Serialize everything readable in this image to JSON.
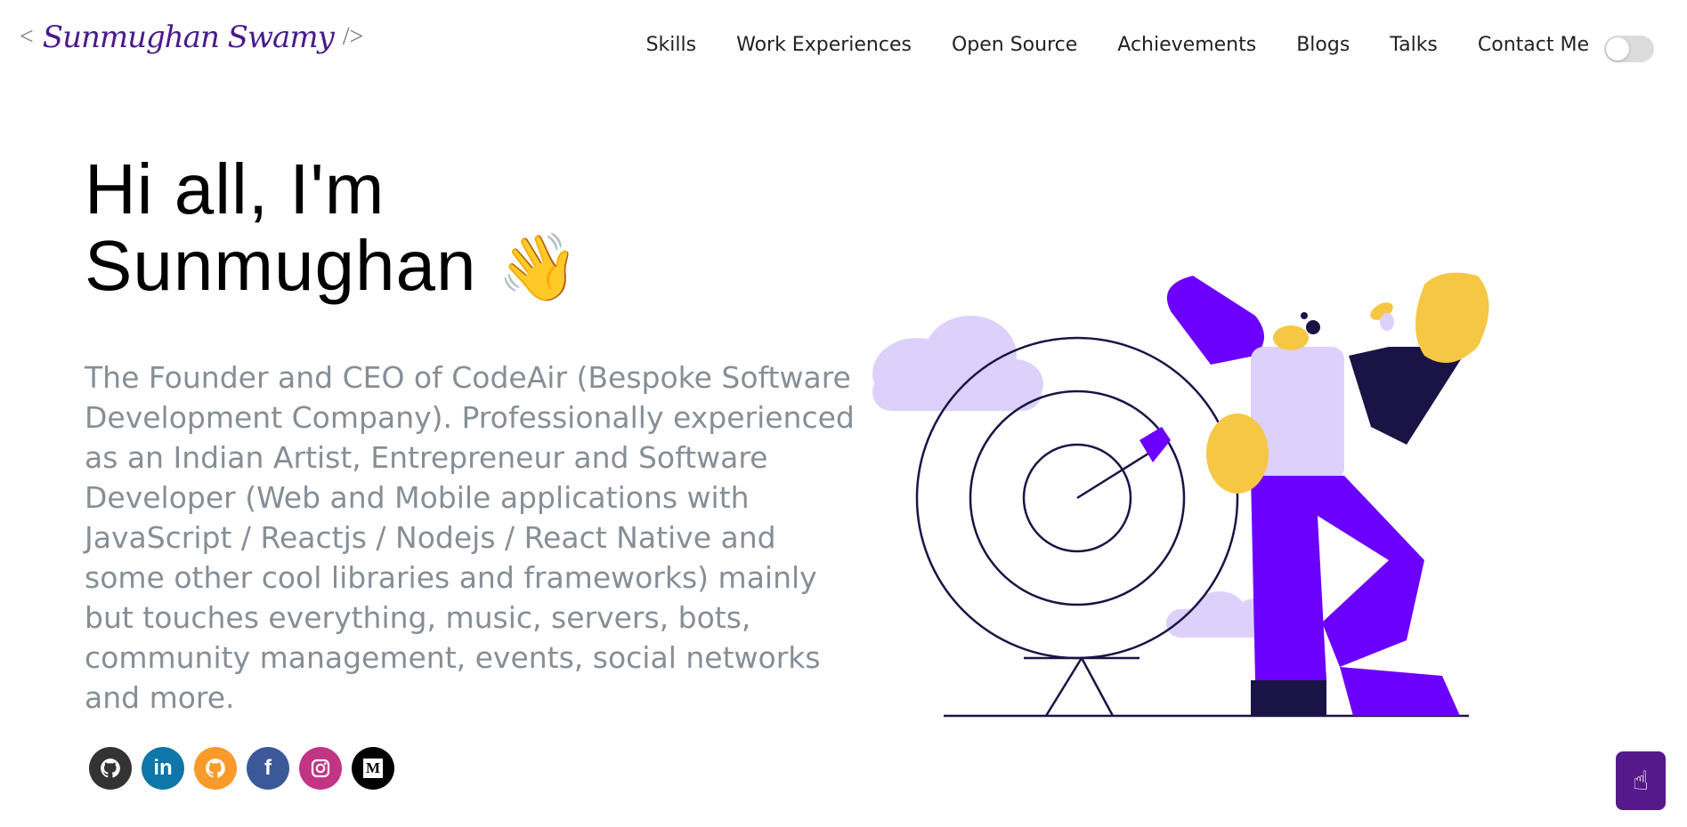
{
  "header": {
    "logo_open": "<",
    "logo_name": "Sunmughan Swamy",
    "logo_close": "/>",
    "nav": [
      "Skills",
      "Work Experiences",
      "Open Source",
      "Achievements",
      "Blogs",
      "Talks",
      "Contact Me"
    ]
  },
  "hero": {
    "greeting_line1": "Hi all, I'm",
    "greeting_line2": "Sunmughan",
    "wave_emoji": "👋",
    "description": "The Founder and CEO of CodeAir (Bespoke Software Development Company). Professionally experienced as an Indian Artist, Entrepreneur and Software Developer (Web and Mobile applications with JavaScript / Reactjs / Nodejs / React Native and some other cool libraries and frameworks) mainly but touches everything, music, servers, bots, community management, events, social networks and more."
  },
  "socials": [
    {
      "name": "github-icon",
      "glyph": "",
      "color": "#333333"
    },
    {
      "name": "linkedin-icon",
      "glyph": "in",
      "color": "#0e76a8"
    },
    {
      "name": "gitlab-icon",
      "glyph": "",
      "color": "#f99a2a"
    },
    {
      "name": "facebook-icon",
      "glyph": "f",
      "color": "#3b5998"
    },
    {
      "name": "instagram-icon",
      "glyph": "",
      "color": "#c13584"
    },
    {
      "name": "medium-icon",
      "glyph": "M",
      "color": "#000000"
    }
  ],
  "colors": {
    "accent": "#55198b",
    "text_secondary": "#868e96",
    "illustration_purple": "#6c00ff",
    "illustration_lavender": "#ddd1fb"
  }
}
